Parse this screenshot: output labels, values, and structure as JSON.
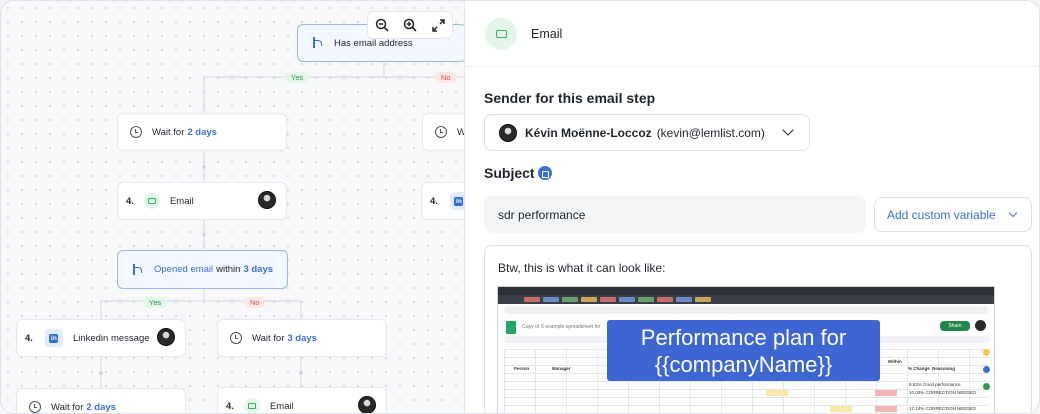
{
  "canvas": {
    "zoom_out_icon": "zoom-out-icon",
    "zoom_in_icon": "zoom-in-icon",
    "fit_icon": "expand-icon",
    "condition_top": {
      "label": "Has email address"
    },
    "yes_label": "Yes",
    "no_label": "No",
    "wait_1": {
      "prefix": "Wait for",
      "value": "2 days"
    },
    "wait_right_partial": "W",
    "email_step": {
      "number": "4.",
      "label": "Email"
    },
    "email_right_number": "4.",
    "condition_opened": {
      "prefix": "Opened email",
      "middle": "within",
      "value": "3 days"
    },
    "yes_label_2": "Yes",
    "no_label_2": "No",
    "linkedin_step": {
      "number": "4.",
      "label": "Linkedin message"
    },
    "wait_3": {
      "prefix": "Wait for",
      "value": "3 days"
    },
    "wait_bottom_left": {
      "prefix": "Wait for",
      "value": "2 days"
    },
    "email_bottom": {
      "number": "4.",
      "label": "Email"
    }
  },
  "panel": {
    "title": "Email",
    "sender_section": "Sender for this email step",
    "sender": {
      "name": "Kévin Moënne-Loccoz",
      "email": "(kevin@lemlist.com)"
    },
    "subject_section": "Subject",
    "subject_value": "sdr performance",
    "add_variable_label": "Add custom variable",
    "body_intro": "Btw, this is what it can look like:",
    "preview": {
      "overlay_line1": "Performance plan for",
      "overlay_line2": "{{companyName}}",
      "share_label": "Share",
      "doc_title": "Copy of X example spreadsheet for",
      "col_person": "Person",
      "col_manager": "Manager",
      "col_within": "Within",
      "col_change": "% Change",
      "col_reasoning": "Reasoning",
      "row1_reason": "9.93% Good performance",
      "row2_reason": "10.00% CORRECTION NEEDED",
      "row3_reason": "17.14% CORRECTION NEEDED"
    }
  },
  "colors": {
    "accent": "#3c6fd6",
    "yes": "#2f9b57",
    "no": "#d24d4d",
    "email_green": "#3bb26b"
  }
}
